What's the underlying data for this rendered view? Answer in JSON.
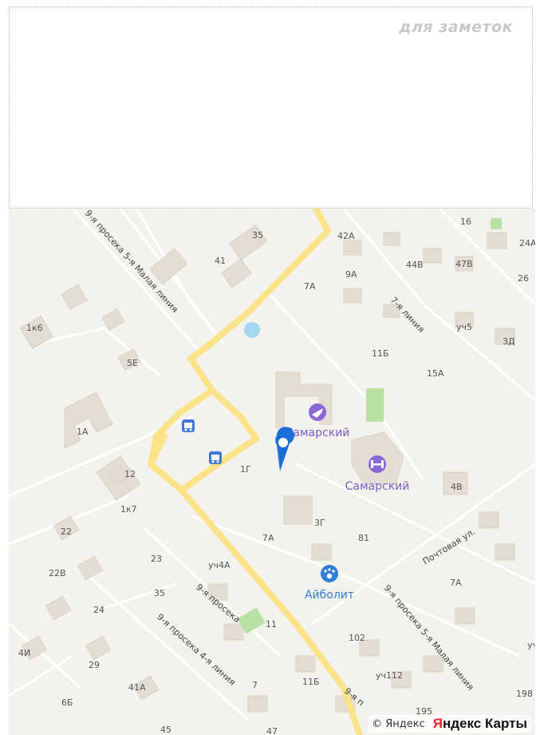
{
  "notes": {
    "label": "для заметок"
  },
  "map": {
    "pois": [
      {
        "name": "Самарский",
        "icon": "airplane-icon",
        "color": "#7c5cc8"
      },
      {
        "name": "Самарский",
        "icon": "fitness-icon",
        "color": "#7c5cc8"
      },
      {
        "name": "Айболит",
        "icon": "paw-icon",
        "color": "#2f7fd6"
      }
    ],
    "streets": [
      "9-я просека 5-я Малая линия",
      "7-я линия",
      "9-я просека",
      "9-я просека 4-я линия",
      "9-я просека 5-я Малая линия",
      "Почтовая ул.",
      "9-я п"
    ],
    "buildings": [
      "35",
      "41",
      "42A",
      "16",
      "24A",
      "44B",
      "47B",
      "26",
      "9A",
      "7A",
      "1к6",
      "уч5",
      "3Д",
      "11Б",
      "5Е",
      "15A",
      "1A",
      "12",
      "1к7",
      "1Г",
      "4B",
      "22",
      "3Г",
      "81",
      "7A",
      "22B",
      "23",
      "уч4A",
      "7A",
      "35",
      "24",
      "102",
      "4И",
      "11",
      "29",
      "уч112",
      "41A",
      "7",
      "11Б",
      "198",
      "6Б",
      "195",
      "45",
      "47",
      "уч"
    ],
    "attribution": {
      "copyright": "© Яндекс",
      "brand_first": "Я",
      "brand_rest": "ндекс Карты"
    },
    "colors": {
      "road": "#fbe38a",
      "building": "#e3ddd3",
      "park": "#b9e0a5",
      "water": "#a5d8f0",
      "marker": "#1a6fd8"
    }
  }
}
